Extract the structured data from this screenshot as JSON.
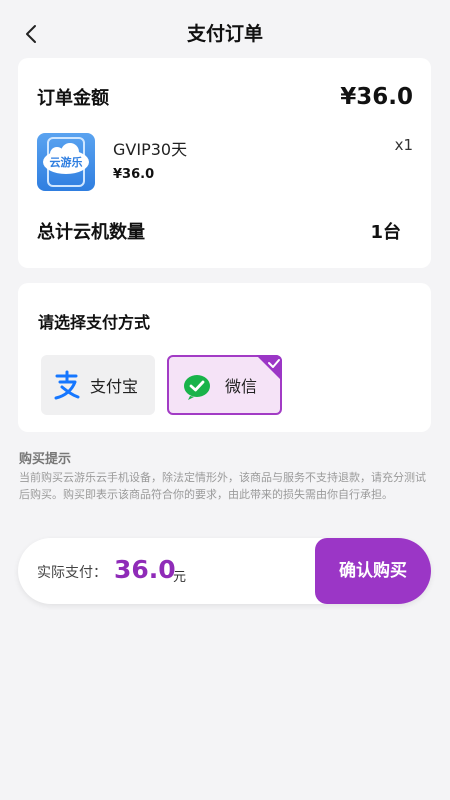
{
  "header": {
    "title": "支付订单"
  },
  "order": {
    "amount_label": "订单金额",
    "amount": "¥36.0",
    "product": {
      "icon_text": "云游乐",
      "name": "GVIP30天",
      "price": "¥36.0",
      "quantity": "x1"
    },
    "count_label": "总计云机数量",
    "count_value": "1台"
  },
  "payment": {
    "title": "请选择支付方式",
    "options": [
      {
        "label": "支付宝",
        "icon": "alipay-icon",
        "selected": false
      },
      {
        "label": "微信",
        "icon": "wechat-icon",
        "selected": true
      }
    ],
    "accent": "#9b36c6"
  },
  "tips": {
    "title": "购买提示",
    "text": "当前购买云游乐云手机设备，除法定情形外，该商品与服务不支持退款，请充分测试后购买。购买即表示该商品符合你的要求，由此带来的损失需由你自行承担。"
  },
  "footer": {
    "actual_label": "实际支付：",
    "actual_amount": "36.0",
    "unit": "元",
    "confirm_label": "确认购买"
  }
}
